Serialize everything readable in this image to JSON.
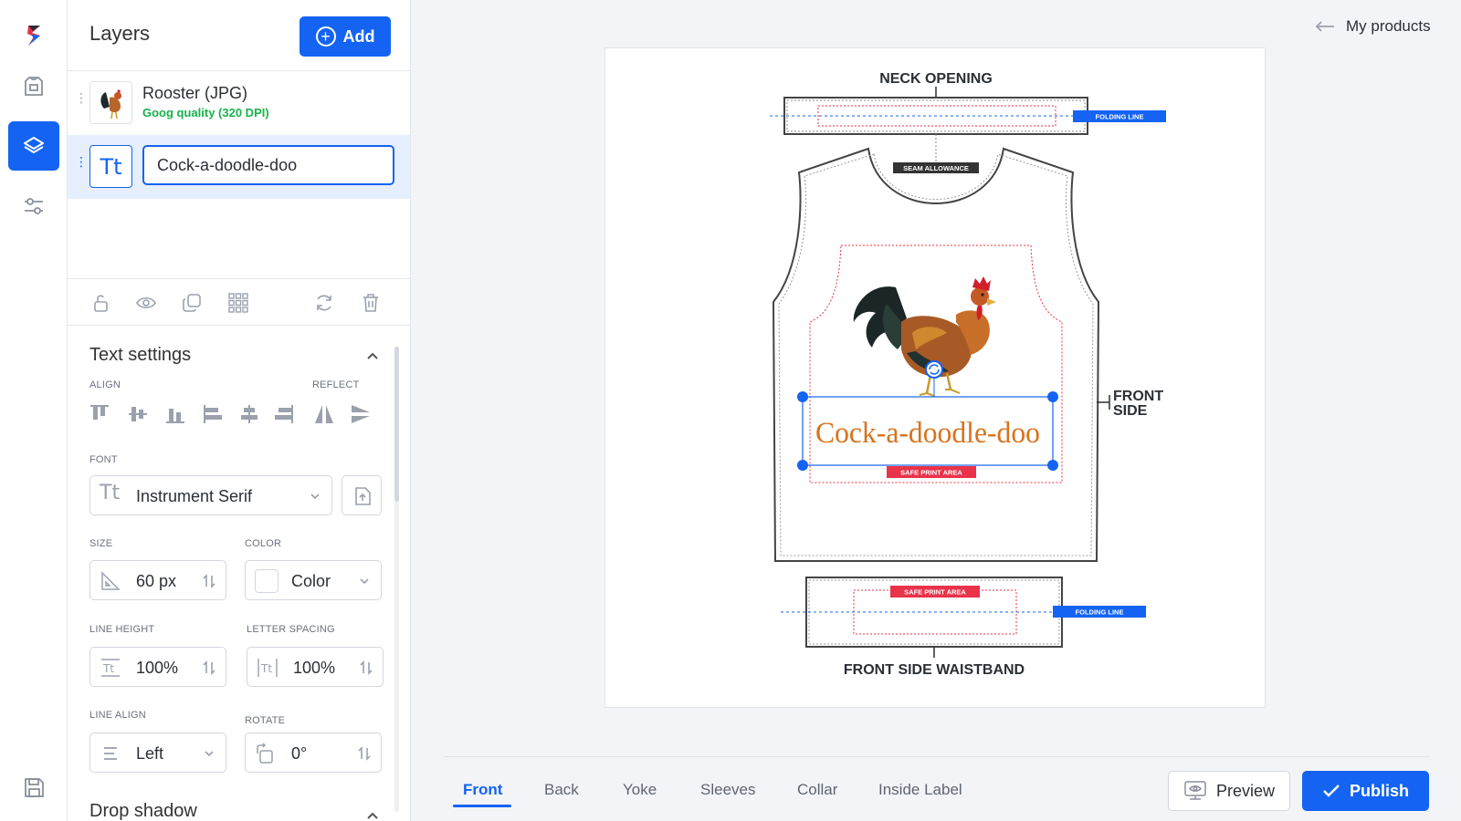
{
  "rail": {
    "items": [
      {
        "name": "logo-icon"
      },
      {
        "name": "product-icon"
      },
      {
        "name": "layers-icon",
        "active": true
      },
      {
        "name": "sliders-icon"
      },
      {
        "name": "save-icon"
      }
    ]
  },
  "layers": {
    "title": "Layers",
    "add_label": "Add",
    "items": [
      {
        "name": "Rooster (JPG)",
        "quality": "Goog quality (320 DPI)",
        "icon": "rooster-thumbnail"
      },
      {
        "value": "Cock-a-doodle-doo",
        "icon": "text-icon",
        "icon_glyph": "Tt"
      }
    ]
  },
  "toolbar": [
    "unlock-icon",
    "eye-icon",
    "duplicate-icon",
    "grid-icon",
    "rotate-icon",
    "trash-icon"
  ],
  "text_settings": {
    "title": "Text settings",
    "align_label": "ALIGN",
    "reflect_label": "REFLECT",
    "font_label": "FONT",
    "font_value": "Instrument Serif",
    "size_label": "SIZE",
    "size_value": "60 px",
    "color_label": "COLOR",
    "color_value": "Color",
    "line_height_label": "LINE HEIGHT",
    "line_height_value": "100%",
    "letter_spacing_label": "LETTER SPACING",
    "letter_spacing_value": "100%",
    "line_align_label": "LINE ALIGN",
    "line_align_value": "Left",
    "rotate_label": "ROTATE",
    "rotate_value": "0°"
  },
  "drop_shadow": {
    "title": "Drop shadow"
  },
  "main": {
    "back_label": "My products",
    "pattern": {
      "neck_opening": "NECK OPENING",
      "folding_line": "FOLDING LINE",
      "seam_allowance": "SEAM ALLOWANCE",
      "front_side_line1": "FRONT",
      "front_side_line2": "SIDE",
      "safe_print_area": "SAFE PRINT AREA",
      "waistband": "FRONT SIDE WAISTBAND",
      "text_layer": "Cock-a-doodle-doo"
    },
    "tabs": [
      "Front",
      "Back",
      "Yoke",
      "Sleeves",
      "Collar",
      "Inside Label"
    ],
    "active_tab": "Front",
    "preview_label": "Preview",
    "publish_label": "Publish"
  },
  "colors": {
    "accent": "#1463f3",
    "quality_green": "#16b34a",
    "text_orange": "#d9721c",
    "safe_area_red": "#e8334a"
  }
}
